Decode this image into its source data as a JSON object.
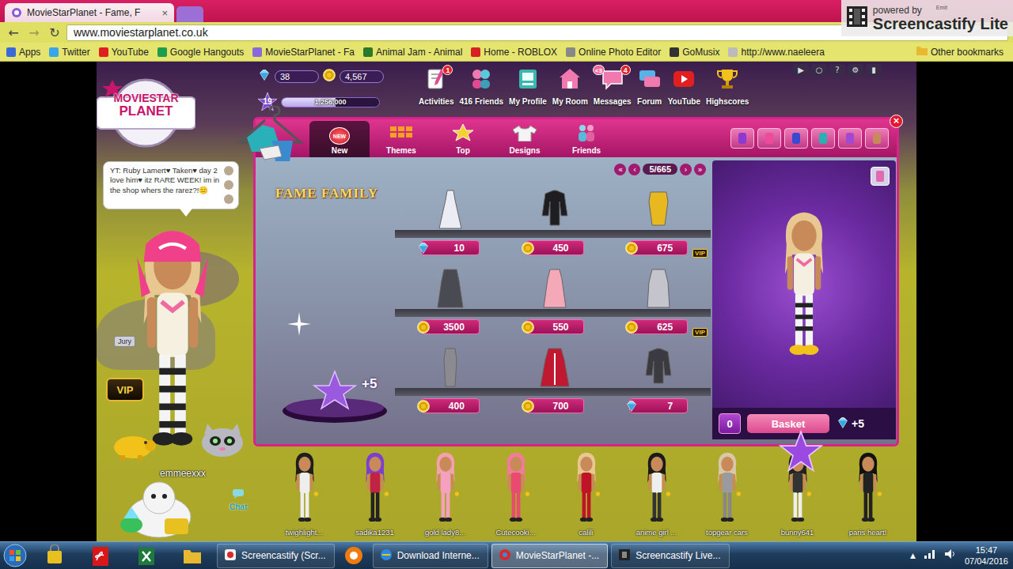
{
  "browser": {
    "tabs": [
      {
        "label": "MovieStarPlanet - Fame, F",
        "close": "×",
        "selected": true
      },
      {
        "selected": false
      }
    ],
    "back": "←",
    "forward": "→",
    "reload": "↻",
    "url": "www.moviestarplanet.co.uk",
    "bookmarks": [
      {
        "label": "Apps",
        "color": "#3a6ad8"
      },
      {
        "label": "Twitter",
        "color": "#39a6e8"
      },
      {
        "label": "YouTube",
        "color": "#e02020"
      },
      {
        "label": "Google Hangouts",
        "color": "#1e9e4a"
      },
      {
        "label": "MovieStarPlanet - Fa",
        "color": "#8a6ad8"
      },
      {
        "label": "Animal Jam - Animal",
        "color": "#2a7a2a"
      },
      {
        "label": "Home - ROBLOX",
        "color": "#d82020"
      },
      {
        "label": "Online Photo Editor",
        "color": "#888888"
      },
      {
        "label": "GoMusix",
        "color": "#333333"
      },
      {
        "label": "http://www.naeleera",
        "color": "#bbbbbb"
      }
    ],
    "other_bookmarks": "Other bookmarks"
  },
  "recorder": {
    "powered_by": "powered by",
    "user": "Emit",
    "brand": "Screencastify Lite"
  },
  "game": {
    "logo": [
      "MOVIESTAR",
      "PLANET"
    ],
    "hud": {
      "diamonds": "38",
      "coins": "4,567",
      "level": "19",
      "fame": "1,256,000",
      "fame_level": 0.55
    },
    "nav": [
      {
        "label": "Activities",
        "badge": "1"
      },
      {
        "label": "416 Friends"
      },
      {
        "label": "My Profile"
      },
      {
        "label": "My Room"
      },
      {
        "label": "Messages",
        "badge": "4",
        "tag": "<3"
      },
      {
        "label": "Forum"
      },
      {
        "label": "YouTube"
      },
      {
        "label": "Highscores"
      }
    ],
    "controls": [
      "▶",
      "○",
      "?",
      "⚙",
      "▮"
    ],
    "shop": {
      "tabs": [
        {
          "label": "New",
          "icon": "NEW",
          "selected": true
        },
        {
          "label": "Themes",
          "selected": false
        },
        {
          "label": "Top",
          "selected": false
        },
        {
          "label": "Designs",
          "selected": false
        },
        {
          "label": "Friends",
          "selected": false
        }
      ],
      "close": "×",
      "theme": {
        "title": "FAME FAMILY",
        "bonus": "+5"
      },
      "pager": {
        "first": "«",
        "prev": "‹",
        "page": "5/665",
        "next": "›",
        "last": "»"
      },
      "vip_label": "VIP",
      "items": [
        {
          "price": "10",
          "kind": "diamonds",
          "vip": false
        },
        {
          "price": "450",
          "kind": "coins",
          "vip": false
        },
        {
          "price": "675",
          "kind": "coins",
          "vip": true
        },
        {
          "price": "3500",
          "kind": "coins",
          "vip": false
        },
        {
          "price": "550",
          "kind": "coins",
          "vip": false
        },
        {
          "price": "625",
          "kind": "coins",
          "vip": true
        },
        {
          "price": "400",
          "kind": "coins",
          "vip": false
        },
        {
          "price": "700",
          "kind": "coins",
          "vip": false
        },
        {
          "price": "7",
          "kind": "diamonds",
          "vip": false
        }
      ],
      "basket": {
        "count": "0",
        "label": "Basket",
        "bonus": "+5"
      }
    },
    "player": {
      "chat": "YT: Ruby Lamert♥ Taken♥ day 2 love him♥ itz RARE WEEK! im in the shop whers the rarez?!😑",
      "tag": "Jury",
      "vip": "VIP",
      "name": "emmeexxx",
      "chat_label": "Chat"
    },
    "crowd": [
      "twighlight...",
      "sadika1231",
      "gold lady8...",
      "Cutecooki...",
      "calili",
      "anime girl ...",
      "topgear cars",
      "bunny641",
      "paris heart!"
    ]
  },
  "taskbar": {
    "tasks": [
      {
        "label": "Screencastify (Scr...",
        "selected": false
      },
      {
        "label": "Download Interne...",
        "selected": false
      },
      {
        "label": "MovieStarPlanet -...",
        "selected": true
      },
      {
        "label": "Screencastify Live...",
        "selected": false
      }
    ],
    "tray": "▲",
    "time": "15:47",
    "date": "07/04/2016"
  }
}
